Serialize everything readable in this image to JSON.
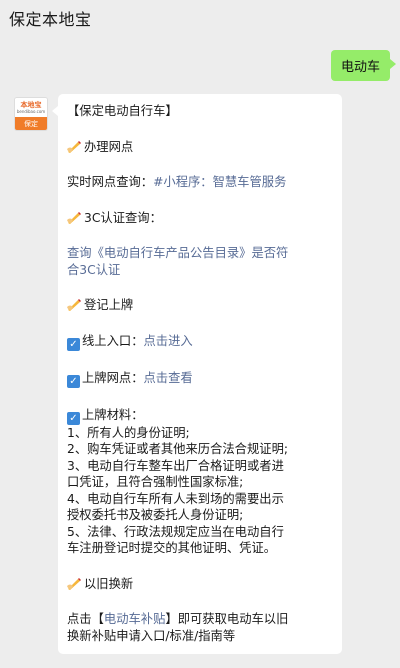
{
  "header": {
    "title": "保定本地宝"
  },
  "outgoing": {
    "text": "电动车"
  },
  "avatar": {
    "brand": "本地宝",
    "brand_sub": "bendibao.com",
    "city": "保定"
  },
  "message": {
    "heading": "【保定电动自行车】",
    "section1_title": "办理网点",
    "realtime_label": "实时网点查询：",
    "realtime_link": "#小程序：智慧车管服务",
    "section2_title": "3C认证查询：",
    "query_link_line1": "查询《电动自行车产品公告目录》是否符",
    "query_link_line2": "合3C认证",
    "section3_title": "登记上牌",
    "online_label": "线上入口：",
    "online_link": "点击进入",
    "outlet_label": "上牌网点：",
    "outlet_link": "点击查看",
    "materials_label": "上牌材料：",
    "materials": [
      "1、所有人的身份证明;",
      "2、购车凭证或者其他来历合法合规证明;",
      "3、电动自行车整车出厂合格证明或者进",
      "口凭证，且符合强制性国家标准;",
      "4、电动自行车所有人未到场的需要出示",
      "授权委托书及被委托人身份证明;",
      "5、法律、行政法规规定应当在电动自行",
      "车注册登记时提交的其他证明、凭证。"
    ],
    "section4_title": "以旧换新",
    "trade_prefix": "点击【",
    "trade_link": "电动车补贴",
    "trade_suffix": "】即可获取电动车以旧",
    "trade_line2": "换新补贴申请入口/标准/指南等"
  }
}
